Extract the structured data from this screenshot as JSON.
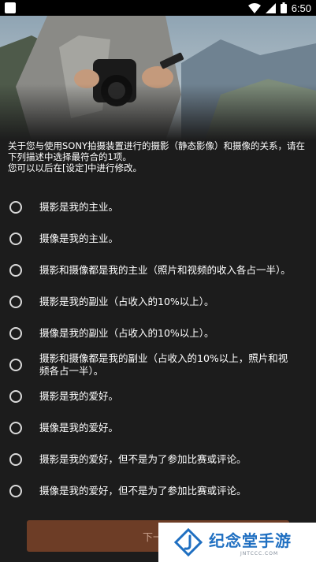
{
  "status_bar": {
    "time": "6:50"
  },
  "intro": {
    "line1": "关于您与使用SONY拍摄装置进行的摄影（静态影像）和摄像的关系，请在下列描述中选择最符合的1项。",
    "line2": "您可以以后在[设定]中进行修改。"
  },
  "options": [
    {
      "label": "摄影是我的主业。"
    },
    {
      "label": "摄像是我的主业。"
    },
    {
      "label": "摄影和摄像都是我的主业（照片和视频的收入各占一半）。"
    },
    {
      "label": "摄影是我的副业（占收入的10%以上）。"
    },
    {
      "label": "摄像是我的副业（占收入的10%以上）。"
    },
    {
      "label": "摄影和摄像都是我的副业（占收入的10%以上，照片和视频各占一半）。"
    },
    {
      "label": "摄影是我的爱好。"
    },
    {
      "label": "摄像是我的爱好。"
    },
    {
      "label": "摄影是我的爱好，但不是为了参加比赛或评论。"
    },
    {
      "label": "摄像是我的爱好，但不是为了参加比赛或评论。"
    }
  ],
  "next_button": {
    "label": "下一步"
  },
  "watermark": {
    "title": "纪念堂手游",
    "subtitle": "JNTCCC.COM"
  },
  "colors": {
    "background": "#1c1c1c",
    "button": "#6d3d26",
    "watermark_blue": "#1f6fc1"
  }
}
